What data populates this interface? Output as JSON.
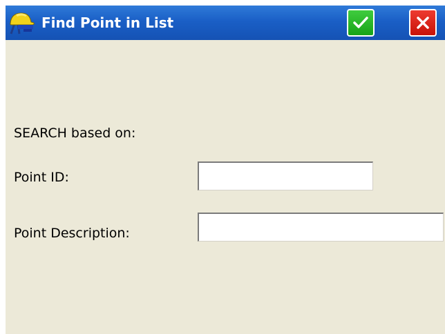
{
  "window": {
    "title": "Find Point in List"
  },
  "form": {
    "search_label": "SEARCH based on:",
    "point_id_label": "Point ID:",
    "point_id_value": "",
    "point_description_label": "Point Description:",
    "point_description_value": ""
  },
  "icons": {
    "app": "surveyor-hardhat-icon",
    "ok": "checkmark-icon",
    "close": "close-icon"
  },
  "colors": {
    "titlebar": "#1a5fc6",
    "ok_button": "#17a317",
    "close_button": "#d8180c",
    "window_background": "#ece9d8"
  }
}
